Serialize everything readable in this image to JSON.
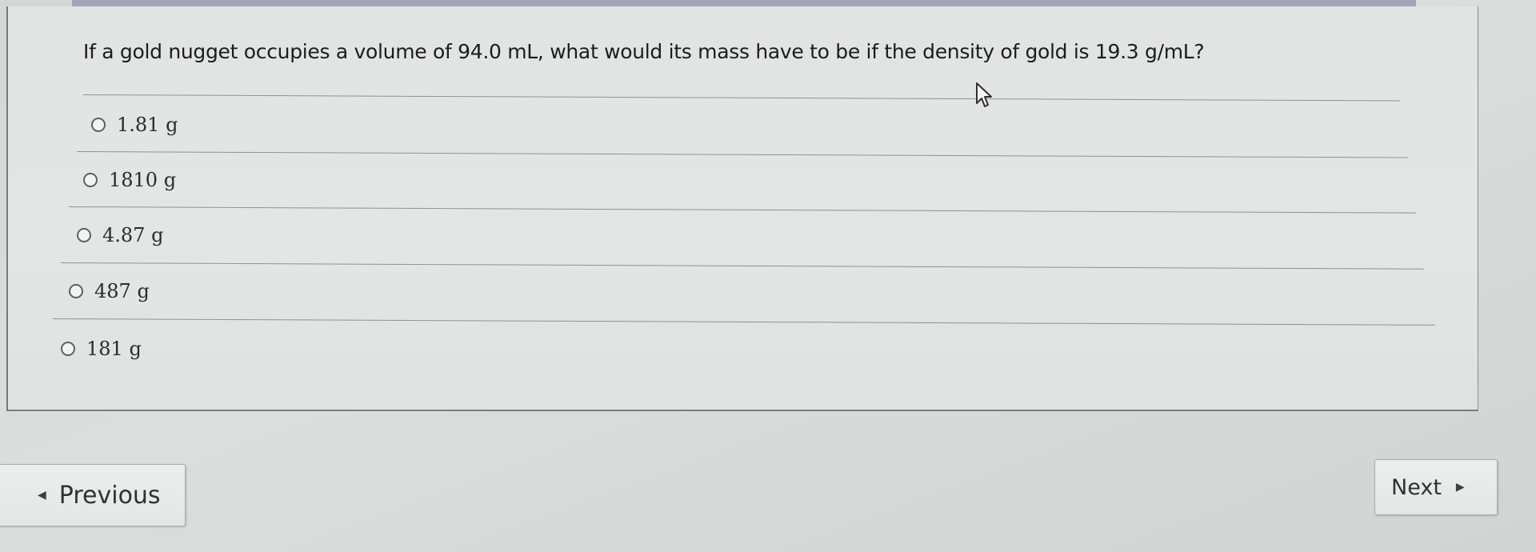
{
  "question": {
    "text": "If a gold nugget occupies a volume of 94.0 mL, what would its mass have to be if the density of gold is 19.3 g/mL?"
  },
  "options": [
    {
      "label": "1.81 g",
      "selected": false
    },
    {
      "label": "1810 g",
      "selected": false
    },
    {
      "label": "4.87 g",
      "selected": false
    },
    {
      "label": "487 g",
      "selected": false
    },
    {
      "label": "181 g",
      "selected": false
    }
  ],
  "navigation": {
    "previous_label": "Previous",
    "next_label": "Next",
    "previous_icon": "triangle-left-icon",
    "next_icon": "triangle-right-icon"
  },
  "icons": {
    "radio": "radio-button-icon",
    "cursor": "mouse-pointer-icon"
  },
  "colors": {
    "background": "#d6dad9",
    "panel": "#e2e5e4",
    "text": "#1b1c1e",
    "header_strip": "#a3a6b8"
  }
}
